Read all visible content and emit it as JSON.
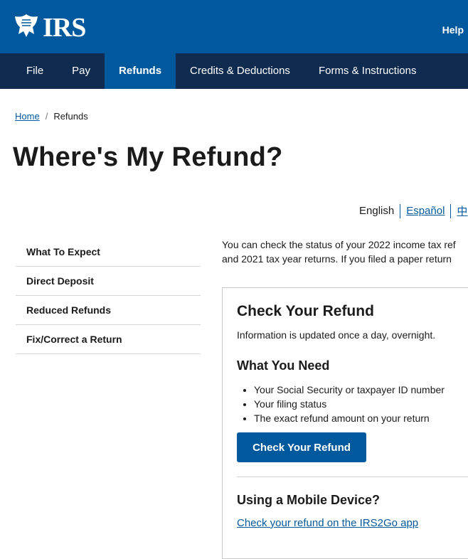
{
  "header": {
    "logo_text": "IRS",
    "help_label": "Help"
  },
  "nav": {
    "items": [
      {
        "label": "File"
      },
      {
        "label": "Pay"
      },
      {
        "label": "Refunds",
        "active": true
      },
      {
        "label": "Credits & Deductions"
      },
      {
        "label": "Forms & Instructions"
      }
    ]
  },
  "breadcrumb": {
    "home": "Home",
    "separator": "/",
    "current": "Refunds"
  },
  "page": {
    "title": "Where's My Refund?"
  },
  "languages": {
    "current": "English",
    "spanish": "Español",
    "chinese": "中"
  },
  "sidebar": {
    "items": [
      {
        "label": "What To Expect"
      },
      {
        "label": "Direct Deposit"
      },
      {
        "label": "Reduced Refunds"
      },
      {
        "label": "Fix/Correct a Return"
      }
    ]
  },
  "main": {
    "intro_line1": "You can check the status of your 2022 income tax ref",
    "intro_line2": "and 2021 tax year returns.  If you filed a paper return"
  },
  "card": {
    "title": "Check Your Refund",
    "info": "Information is updated once a day, overnight.",
    "need_heading": "What You Need",
    "needs": [
      "Your Social Security or taxpayer ID number",
      "Your filing status",
      "The exact refund amount on your return"
    ],
    "button_label": "Check Your Refund",
    "mobile_heading": "Using a Mobile Device?",
    "mobile_link": "Check your refund on the IRS2Go app"
  },
  "colors": {
    "brand_blue": "#00599c",
    "nav_dark": "#0f2b4f"
  },
  "icons": {
    "logo": "irs-eagle-icon"
  }
}
